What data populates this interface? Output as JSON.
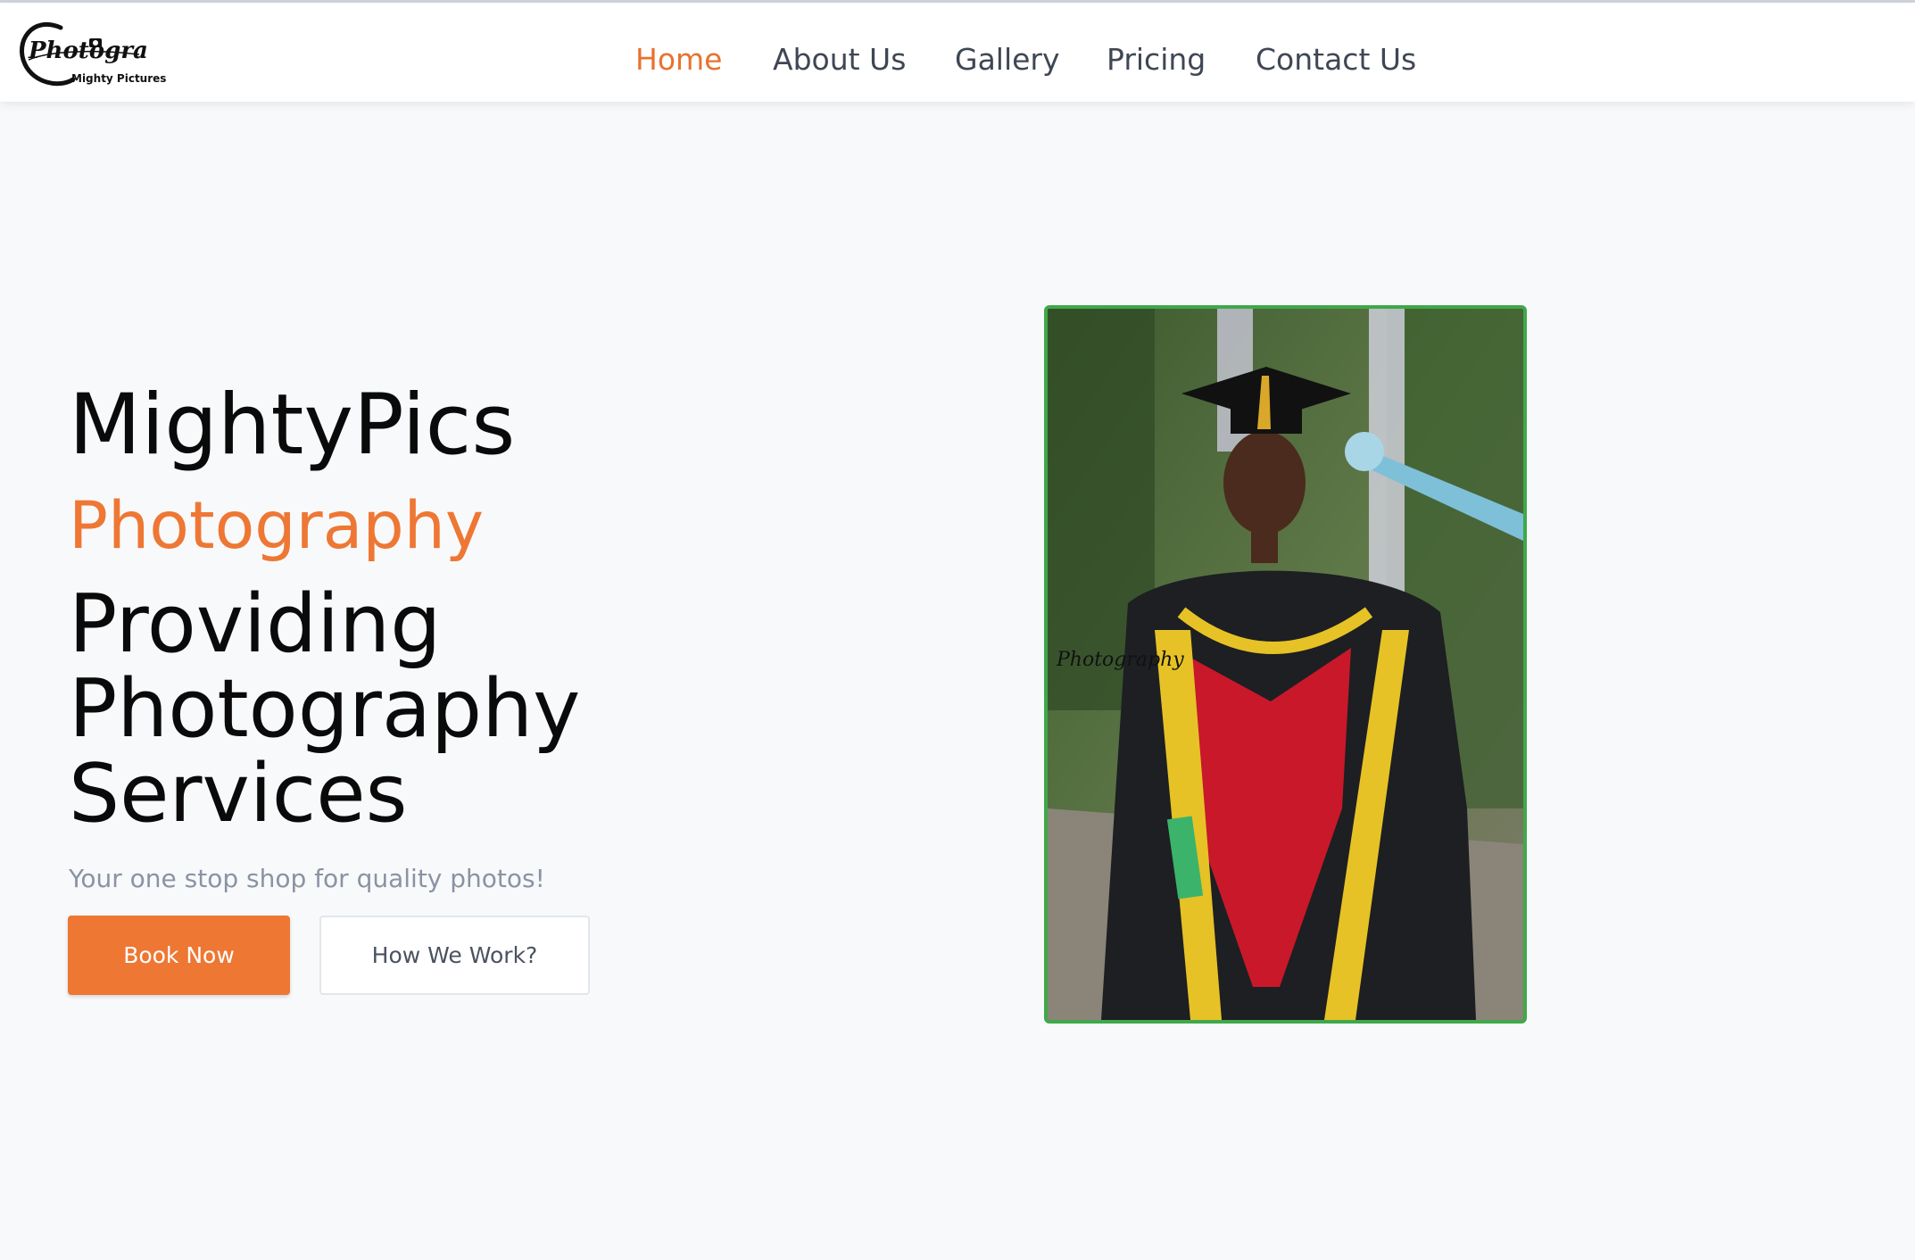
{
  "header": {
    "logo": {
      "script_text": "Photography",
      "subtitle": "Mighty Pictures"
    },
    "nav": [
      {
        "label": "Home",
        "active": true
      },
      {
        "label": "About Us",
        "active": false
      },
      {
        "label": "Gallery",
        "active": false
      },
      {
        "label": "Pricing",
        "active": false
      },
      {
        "label": "Contact Us",
        "active": false
      }
    ]
  },
  "hero": {
    "brand": "MightyPics",
    "accent": "Photography",
    "headline_lines": [
      "Providing",
      "Photography",
      "Services"
    ],
    "tagline": "Your one stop shop for quality photos!",
    "primary_button": "Book Now",
    "secondary_button": "How We Work?"
  },
  "photo": {
    "description_icon": "graduate-photo",
    "watermark": "Photography"
  },
  "colors": {
    "accent": "#ee7734",
    "nav_text": "#3f4654",
    "photo_border": "#3fa84a",
    "background": "#f8f9fb"
  }
}
